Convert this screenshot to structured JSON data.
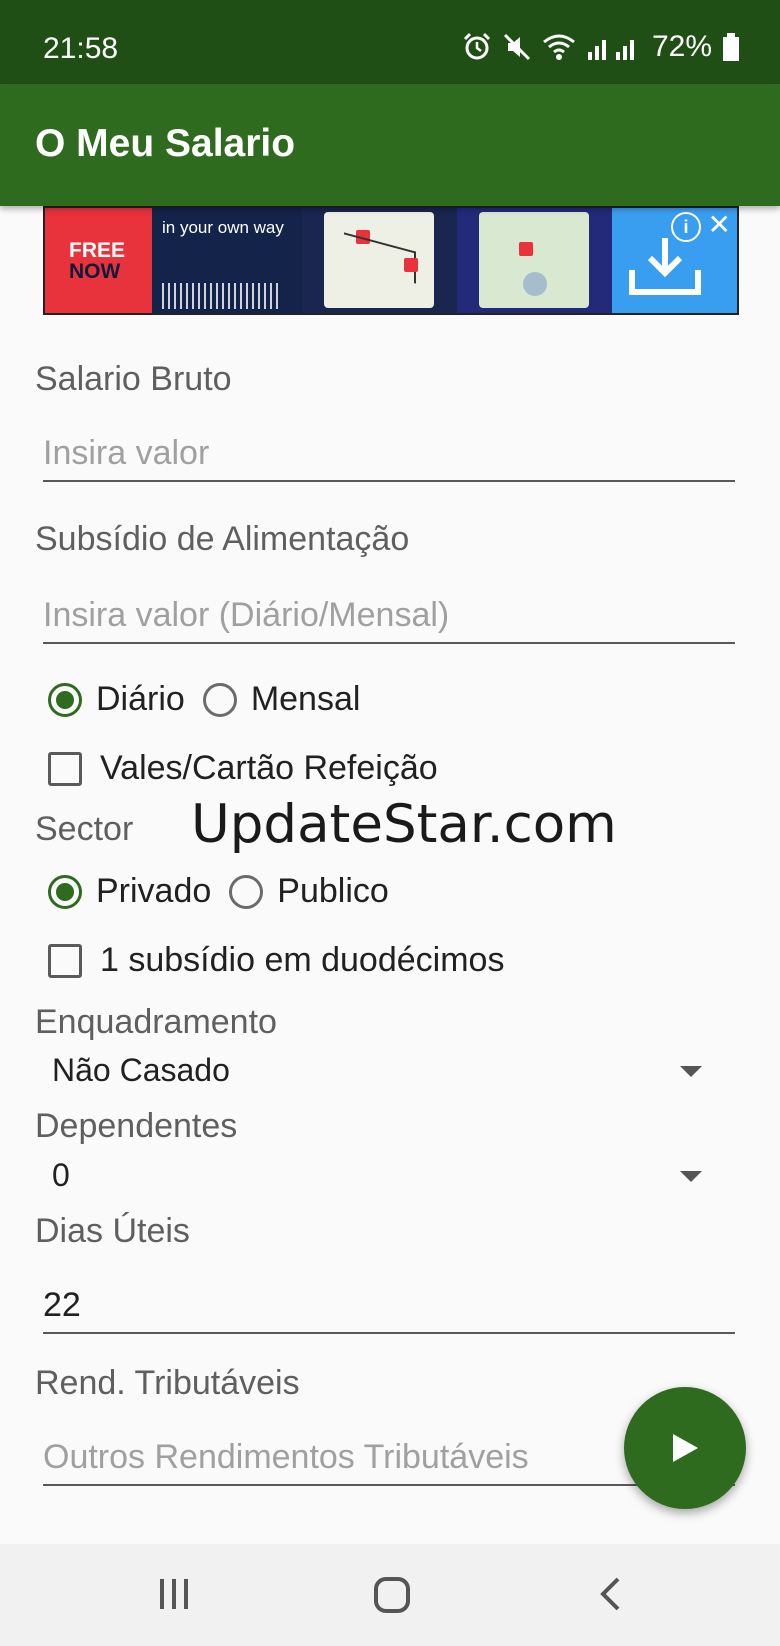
{
  "status_bar": {
    "time": "21:58",
    "battery": "72%"
  },
  "app_bar": {
    "title": "O Meu Salario"
  },
  "ad": {
    "brand_line1": "FREE",
    "brand_line2": "NOW",
    "tagline": "in your own way"
  },
  "form": {
    "salario_bruto": {
      "label": "Salario Bruto",
      "placeholder": "Insira valor",
      "value": ""
    },
    "subsidio": {
      "label": "Subsídio de Alimentação",
      "placeholder": "Insira valor (Diário/Mensal)",
      "value": ""
    },
    "subsidio_periodo": {
      "option1": "Diário",
      "option2": "Mensal",
      "selected": "Diário"
    },
    "vales": {
      "label": "Vales/Cartão Refeição",
      "checked": false
    },
    "sector": {
      "label": "Sector",
      "option1": "Privado",
      "option2": "Publico",
      "selected": "Privado"
    },
    "duodecimos": {
      "label": "1 subsídio em duodécimos",
      "checked": false
    },
    "enquadramento": {
      "label": "Enquadramento",
      "value": "Não Casado"
    },
    "dependentes": {
      "label": "Dependentes",
      "value": "0"
    },
    "dias_uteis": {
      "label": "Dias Úteis",
      "value": "22"
    },
    "rend_tributaveis": {
      "label": "Rend. Tributáveis",
      "placeholder": "Outros Rendimentos Tributáveis",
      "value": ""
    }
  },
  "watermark": "UpdateStar.com",
  "colors": {
    "status_bar": "#1f4f14",
    "app_bar": "#2e6b1f",
    "accent": "#2e6b1f"
  },
  "icons": [
    "alarm-icon",
    "mute-icon",
    "wifi-icon",
    "signal-icon",
    "battery-icon",
    "play-icon",
    "recents-icon",
    "home-icon",
    "back-icon"
  ]
}
